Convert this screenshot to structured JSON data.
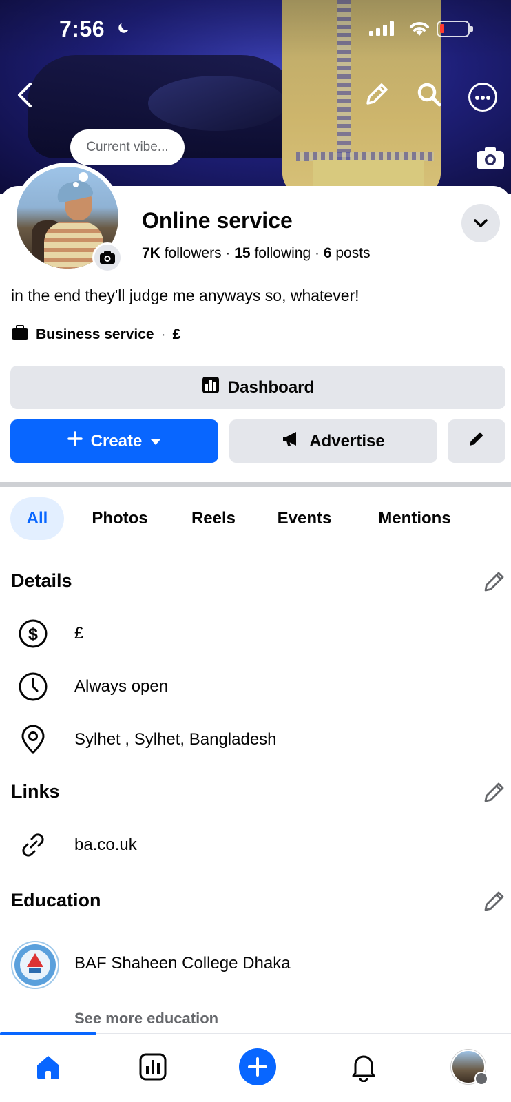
{
  "status_bar": {
    "time": "7:56"
  },
  "profile": {
    "vibe_placeholder": "Current vibe...",
    "name": "Online service",
    "followers_count": "7K",
    "followers_label": "followers",
    "following_count": "15",
    "following_label": "following",
    "posts_count": "6",
    "posts_label": "posts",
    "bio": "in the end they'll judge me anyways so, whatever!",
    "category": "Business service",
    "category_price": "£"
  },
  "actions": {
    "dashboard": "Dashboard",
    "create": "Create",
    "advertise": "Advertise"
  },
  "tabs": [
    "All",
    "Photos",
    "Reels",
    "Events",
    "Mentions"
  ],
  "details": {
    "title": "Details",
    "price": "£",
    "hours": "Always open",
    "location": "Sylhet , Sylhet, Bangladesh"
  },
  "links": {
    "title": "Links",
    "url": "ba.co.uk"
  },
  "education": {
    "title": "Education",
    "school": "BAF Shaheen College Dhaka",
    "see_more": "See more education"
  },
  "colors": {
    "accent": "#0866ff",
    "button_gray": "#e4e6eb",
    "tab_active_bg": "#e3efff",
    "battery_low": "#ff3b30"
  },
  "icons": {
    "back": "chevron-left-icon",
    "edit_cover": "pencil-icon",
    "search": "search-icon",
    "more": "more-icon",
    "cover_camera": "camera-icon",
    "nav": [
      "home-icon",
      "dashboard-icon",
      "plus-icon",
      "bell-icon",
      "avatar"
    ]
  }
}
